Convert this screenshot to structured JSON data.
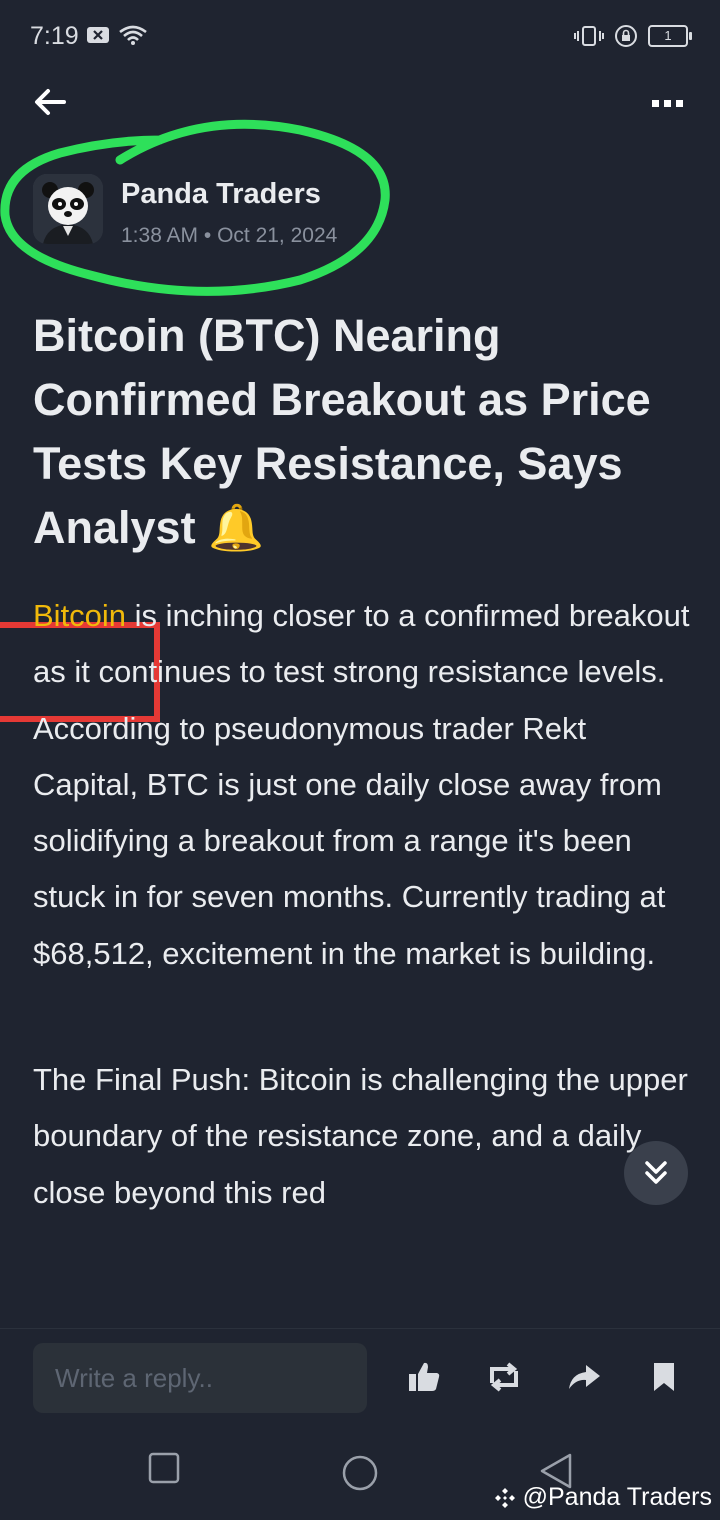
{
  "status_bar": {
    "time": "7:19",
    "battery_level": "1"
  },
  "author": {
    "name": "Panda Traders",
    "meta": "1:38 AM • Oct 21, 2024"
  },
  "headline": {
    "text": "Bitcoin (BTC) Nearing Confirmed Breakout as Price Tests Key Resistance, Says Analyst 🔔"
  },
  "article": {
    "p1_link": "Bitcoin",
    "p1_rest": " is inching closer to a confirmed breakout as it continues to test strong resistance levels. According to pseudonymous trader Rekt Capital, BTC is just one daily close away from solidifying a breakout from a range it's been stuck in for seven months. Currently trading at $68,512, excitement in the market is building.",
    "p2": "The Final Push: Bitcoin is challenging the upper boundary of the resistance zone, and a daily close beyond this red"
  },
  "reply": {
    "placeholder": "Write a reply.."
  },
  "watermark": {
    "text": "@Panda Traders"
  },
  "colors": {
    "background": "#1f2430",
    "accent": "#f0b90b",
    "annotation_green": "#2ee05a",
    "annotation_red": "#e53935"
  }
}
